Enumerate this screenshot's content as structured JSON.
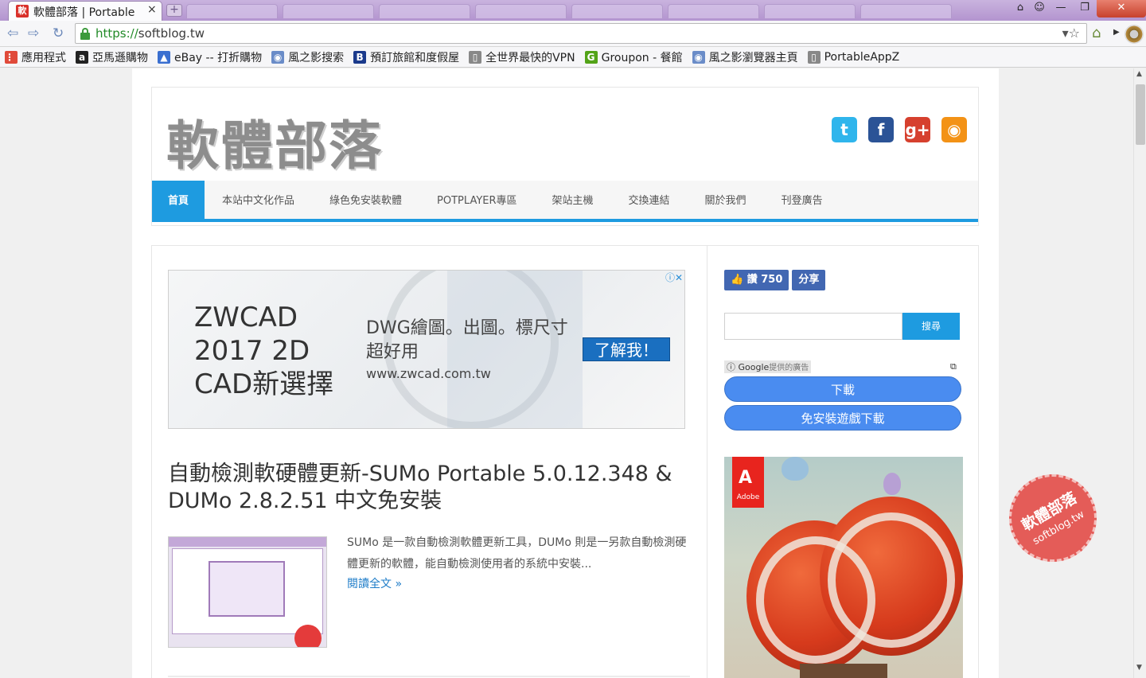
{
  "browser": {
    "tab_title": "軟體部落 | Portable",
    "tab_close": "×",
    "tab_favicon_text": "軟",
    "new_tab": "+",
    "url_protocol": "https://",
    "url_host": "softblog.tw",
    "omnibox_icons": "▾☆",
    "window": {
      "minimize": "—",
      "restore": "❐",
      "close": "✕"
    }
  },
  "bookmarks": [
    {
      "label": "應用程式",
      "icon_text": "⋮⋮",
      "icon_color": "#e04a3a"
    },
    {
      "label": "亞馬遜購物",
      "icon_text": "a",
      "icon_color": "#222222"
    },
    {
      "label": "eBay -- 打折購物",
      "icon_text": "▲",
      "icon_color": "#3a6fd0"
    },
    {
      "label": "風之影搜索",
      "icon_text": "◉",
      "icon_color": "#6a8cc8"
    },
    {
      "label": "預訂旅館和度假屋",
      "icon_text": "B",
      "icon_color": "#1b3a8c"
    },
    {
      "label": "全世界最快的VPN",
      "icon_text": "▯",
      "icon_color": "#888888"
    },
    {
      "label": "Groupon - 餐館",
      "icon_text": "G",
      "icon_color": "#53a318"
    },
    {
      "label": "風之影瀏覽器主頁",
      "icon_text": "◉",
      "icon_color": "#6a8cc8"
    },
    {
      "label": "PortableAppZ",
      "icon_text": "▯",
      "icon_color": "#888888"
    }
  ],
  "site": {
    "logo": "軟體部落",
    "social": [
      {
        "name": "twitter",
        "glyph": "t",
        "color": "#2fb5ec"
      },
      {
        "name": "facebook",
        "glyph": "f",
        "color": "#2b5396"
      },
      {
        "name": "google-plus",
        "glyph": "g+",
        "color": "#d6402e"
      },
      {
        "name": "rss",
        "glyph": "◉",
        "color": "#f39216"
      }
    ],
    "nav": [
      "首頁",
      "本站中文化作品",
      "綠色免安裝軟體",
      "POTPLAYER專區",
      "架站主機",
      "交換連結",
      "關於我們",
      "刊登廣告"
    ],
    "accent": "#1e9be0"
  },
  "ad_banner": {
    "title": "ZWCAD 2017 2D CAD新選擇",
    "subtitle": "DWG繪圖。出圖。標尺寸超好用",
    "url": "www.zwcad.com.tw",
    "cta": "了解我！",
    "choice_icons": "ⓘ✕"
  },
  "post": {
    "title": "自動檢測軟硬體更新-SUMo Portable 5.0.12.348 & DUMo 2.8.2.51 中文免安裝",
    "excerpt": "SUMo 是一款自動檢測軟體更新工具，DUMo 則是一另款自動檢測硬體更新的軟體，能自動檢測使用者的系統中安裝...",
    "read_more": "閱讀全文 »"
  },
  "sidebar": {
    "like_label": "讚 750",
    "share_label": "分享",
    "search_button": "搜尋",
    "google_label": "ⓘ Google",
    "google_sub": "提供的廣告",
    "open_icon": "⧉",
    "ad_links": [
      "下載",
      "免安裝遊戲下載"
    ],
    "adobe_text": "Adobe",
    "adobe_mark": "A"
  },
  "watermark": {
    "line1": "軟體部落",
    "line2": "softblog.tw"
  }
}
